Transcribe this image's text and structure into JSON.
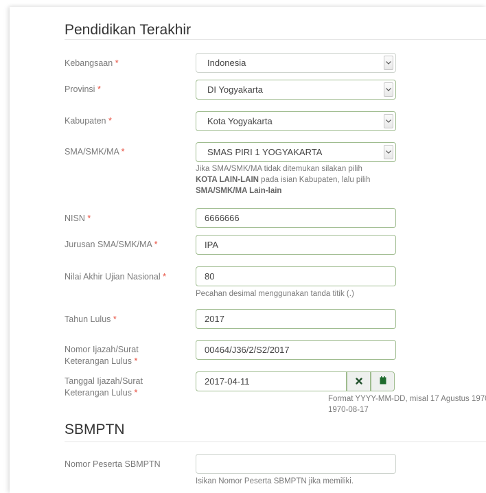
{
  "section1": {
    "title": "Pendidikan Terakhir"
  },
  "required_mark": "*",
  "fields": {
    "kebangsaan": {
      "label": "Kebangsaan",
      "value": "Indonesia"
    },
    "provinsi": {
      "label": "Provinsi",
      "value": "DI Yogyakarta"
    },
    "kabupaten": {
      "label": "Kabupaten",
      "value": "Kota Yogyakarta"
    },
    "sma": {
      "label": "SMA/SMK/MA",
      "value": "SMAS PIRI 1 YOGYAKARTA",
      "help_1": "Jika SMA/SMK/MA tidak ditemukan silakan pilih",
      "help_2_bold": "KOTA LAIN-LAIN",
      "help_2_rest": " pada isian Kabupaten, lalu pilih",
      "help_3_bold": "SMA/SMK/MA Lain-lain"
    },
    "nisn": {
      "label": "NISN",
      "value": "6666666"
    },
    "jurusan": {
      "label": "Jurusan SMA/SMK/MA",
      "value": "IPA"
    },
    "nilai": {
      "label": "Nilai Akhir Ujian Nasional",
      "value": "80",
      "help": "Pecahan desimal menggunakan tanda titik (.)"
    },
    "tahun_lulus": {
      "label": "Tahun Lulus",
      "value": "2017"
    },
    "nomor_ijazah": {
      "label_1": "Nomor Ijazah/Surat",
      "label_2": "Keterangan Lulus",
      "value": "00464/J36/2/S2/2017"
    },
    "tanggal_ijazah": {
      "label_1": "Tanggal Ijazah/Surat",
      "label_2": "Keterangan Lulus",
      "value": "2017-04-11",
      "help_1": "Format YYYY-MM-DD, misal 17 Agustus 1970",
      "help_2": "1970-08-17"
    }
  },
  "section2": {
    "title": "SBMPTN"
  },
  "sbmptn": {
    "label": "Nomor Peserta SBMPTN",
    "value": "",
    "help": "Isikan Nomor Peserta SBMPTN jika memiliki."
  },
  "icons": {
    "dropdown": "chevron-down-icon",
    "clear": "close-icon",
    "calendar": "calendar-icon"
  },
  "colors": {
    "required": "#e74c3c",
    "field_border": "#9fbc8f",
    "button_icon": "#1f6b2e"
  }
}
